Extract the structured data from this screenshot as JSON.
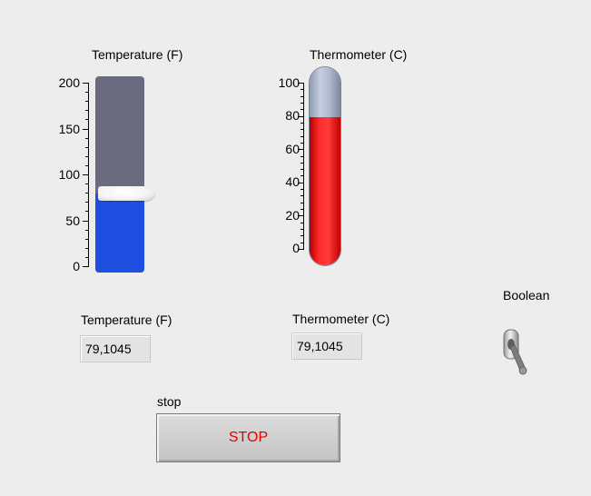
{
  "tank": {
    "label": "Temperature (F)",
    "value": 79.1045,
    "scale": {
      "min": 0,
      "max": 200,
      "labels": [
        "200",
        "150",
        "100",
        "50",
        "0"
      ]
    },
    "colors": {
      "fill": "#1f4fe0",
      "empty": "#6b6b7f"
    }
  },
  "thermometer": {
    "label": "Thermometer (C)",
    "value": 79.1045,
    "scale": {
      "min": 0,
      "max": 100,
      "labels": [
        "100",
        "80",
        "60",
        "40",
        "20",
        "0"
      ]
    },
    "colors": {
      "mercury": "#ff2a2a",
      "glass": "#b7c2d8"
    }
  },
  "indicators": {
    "temperature_f": {
      "label": "Temperature (F)",
      "value": "79,1045"
    },
    "thermometer_c": {
      "label": "Thermometer (C)",
      "value": "79,1045"
    }
  },
  "boolean_switch": {
    "label": "Boolean",
    "state": false
  },
  "stop": {
    "caption": "stop",
    "button_label": "STOP",
    "label_color": "#e00000"
  }
}
